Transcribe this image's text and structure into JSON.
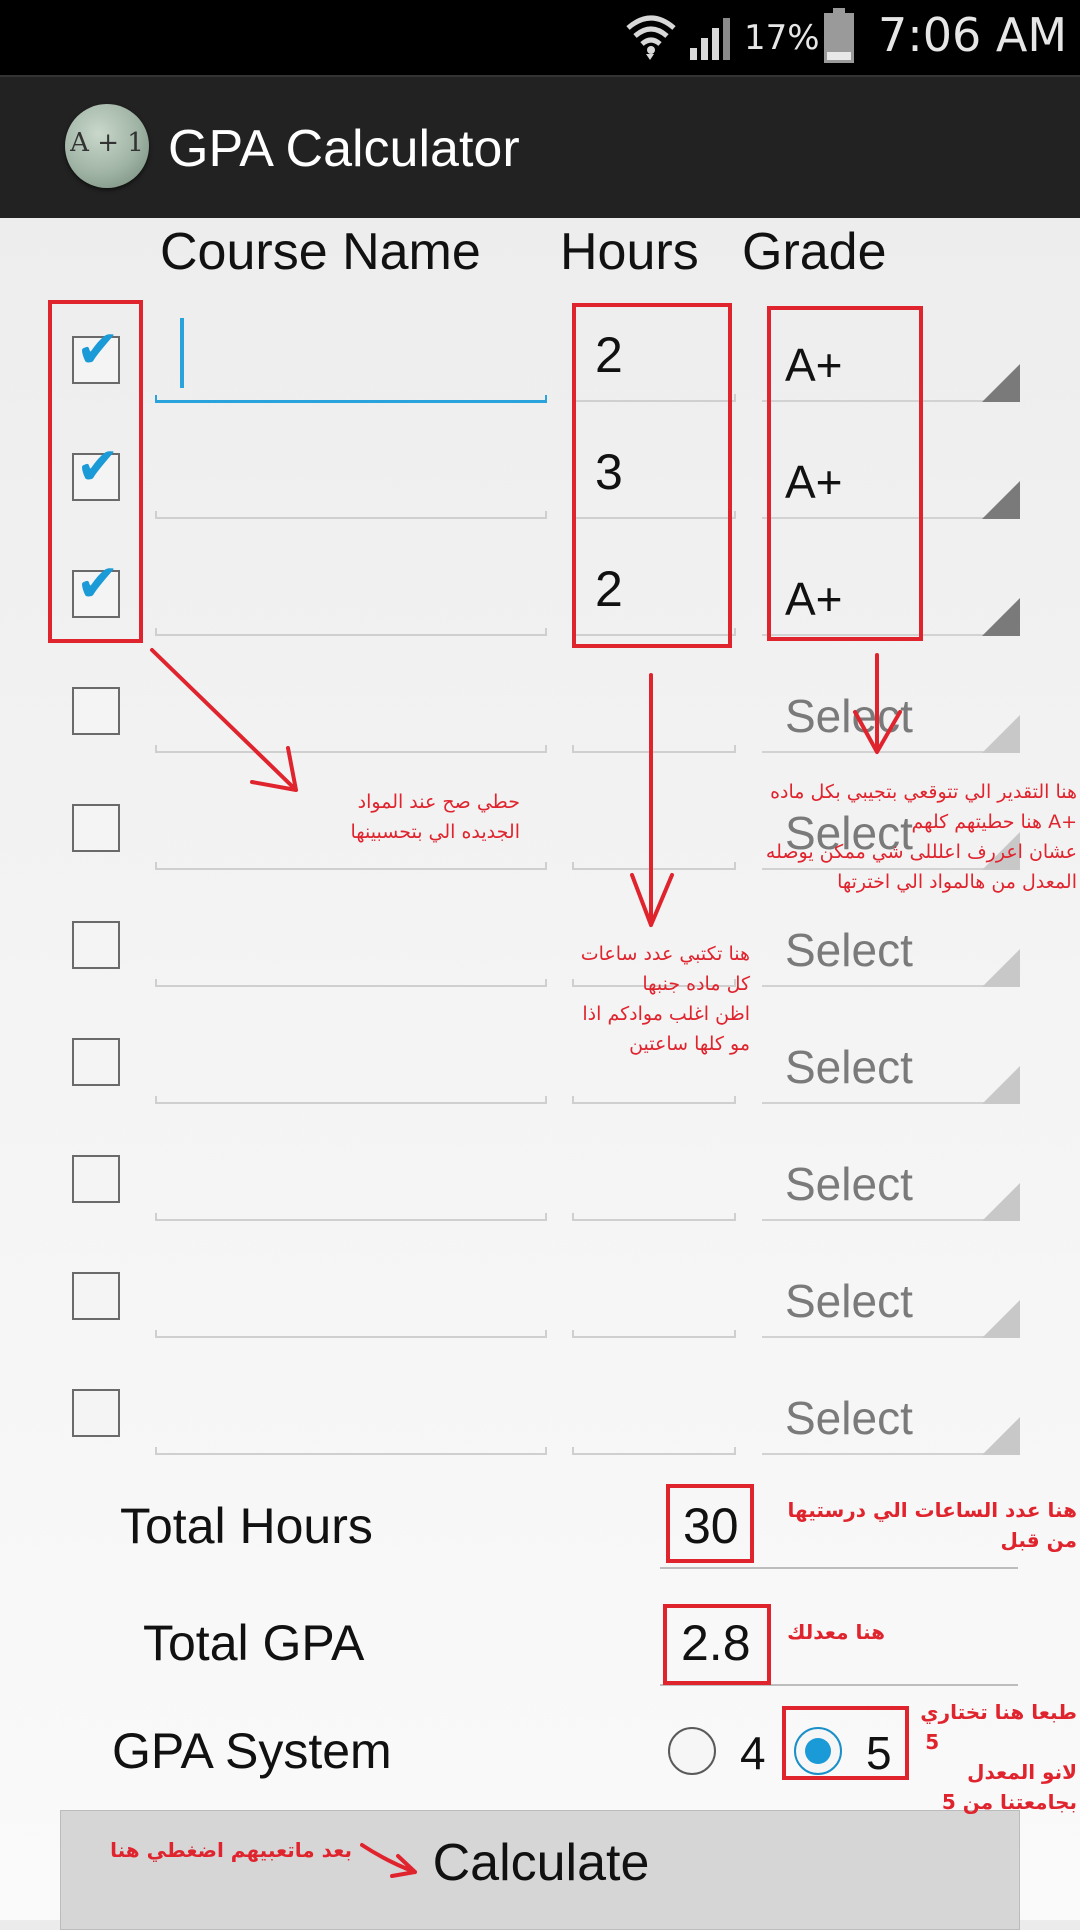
{
  "status_bar": {
    "battery_percent": "17%",
    "time": "7:06 AM"
  },
  "app": {
    "title": "GPA Calculator",
    "icon_text": "A + 1"
  },
  "headers": {
    "course_name": "Course Name",
    "hours": "Hours",
    "grade": "Grade"
  },
  "rows": [
    {
      "checked": true,
      "hours": "2",
      "grade": "A+"
    },
    {
      "checked": true,
      "hours": "3",
      "grade": "A+"
    },
    {
      "checked": true,
      "hours": "2",
      "grade": "A+"
    },
    {
      "checked": false,
      "hours": "",
      "grade": "Select"
    },
    {
      "checked": false,
      "hours": "",
      "grade": "Select"
    },
    {
      "checked": false,
      "hours": "",
      "grade": "Select"
    },
    {
      "checked": false,
      "hours": "",
      "grade": "Select"
    },
    {
      "checked": false,
      "hours": "",
      "grade": "Select"
    },
    {
      "checked": false,
      "hours": "",
      "grade": "Select"
    },
    {
      "checked": false,
      "hours": "",
      "grade": "Select"
    }
  ],
  "summary": {
    "total_hours_label": "Total Hours",
    "total_hours_value": "30",
    "total_gpa_label": "Total GPA",
    "total_gpa_value": "2.8",
    "gpa_system_label": "GPA System",
    "options": [
      "4",
      "5"
    ],
    "selected": "5"
  },
  "calculate_label": "Calculate",
  "annotations": {
    "checkbox_note": [
      "حطي صح عند المواد",
      "الجديده الي بتحسبينها"
    ],
    "hours_note": [
      "هنا تكتبي عدد ساعات",
      "كل ماده جنبها",
      "اظن اغلب موادكم اذا",
      "مو كلها ساعتين"
    ],
    "grade_note": [
      "هنا التقدير الي تتوقعي بتجيبي بكل ماده",
      "+A هنا حطيتهم كلهم",
      "عشان اعررف اعلللى شي ممكن يوصله",
      "المعدل من هالمواد الي اخترتها"
    ],
    "total_hours_note": [
      "هنا عدد الساعات الي درستيها",
      "من قبل"
    ],
    "gpa_note": [
      "هنا معدلك"
    ],
    "system_note": [
      "طبعا هنا تختاري",
      "5",
      "لانو المعدل",
      "بجامعتنا من 5"
    ],
    "calculate_note": "بعد ماتعبيهم اضغطي هنا"
  },
  "colors": {
    "accent": "#1a9ad6",
    "annotation_red": "#e0242e",
    "action_bar": "#222222"
  },
  "icons": [
    "wifi-icon",
    "signal-icon",
    "battery-icon",
    "check-icon",
    "dropdown-triangle-icon",
    "radio-icon"
  ]
}
